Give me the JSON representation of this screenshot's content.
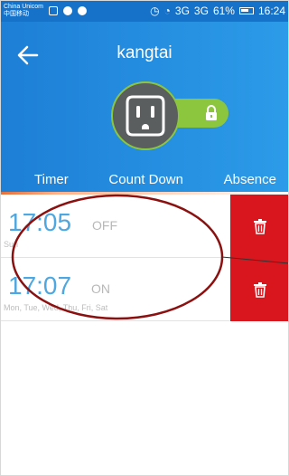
{
  "status_bar": {
    "carrier_line1": "China Unicom",
    "carrier_line2": "中国移动",
    "signal1": "3G",
    "signal2": "3G",
    "battery_text": "61%",
    "time": "16:24"
  },
  "header": {
    "title": "kangtai",
    "icons": {
      "back": "back-arrow-icon",
      "outlet": "power-outlet-icon",
      "lock": "lock-icon"
    }
  },
  "tabs": [
    {
      "label": "Timer",
      "active": true
    },
    {
      "label": "Count Down",
      "active": false
    },
    {
      "label": "Absence",
      "active": false
    }
  ],
  "timers": [
    {
      "time": "17:05",
      "state": "OFF",
      "days": "Sun",
      "delete_icon": "trash-icon"
    },
    {
      "time": "17:07",
      "state": "ON",
      "days": "Mon, Tue, Wed, Thu, Fri, Sat",
      "delete_icon": "trash-icon"
    }
  ],
  "colors": {
    "header": "#2c9be8",
    "status_bar": "#1672c8",
    "accent_green": "#8cc63f",
    "delete_red": "#d9161d",
    "time_blue": "#4ea7e0",
    "annotation_red": "#8b1010"
  }
}
